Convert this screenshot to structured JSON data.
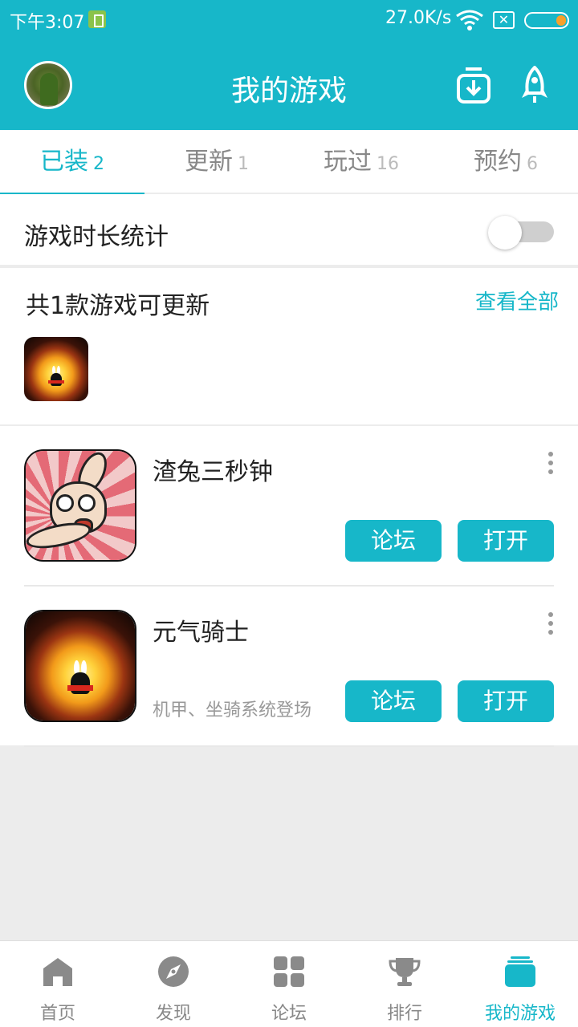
{
  "status_bar": {
    "time": "下午3:07",
    "network_speed": "27.0K/s",
    "icons": [
      "battery-saver-icon",
      "wifi-icon",
      "no-sim-icon",
      "battery-icon"
    ]
  },
  "header": {
    "title": "我的游戏",
    "icons": [
      "avatar",
      "download-icon",
      "rocket-icon"
    ]
  },
  "tabs": [
    {
      "label": "已装",
      "count": "2",
      "active": true
    },
    {
      "label": "更新",
      "count": "1",
      "active": false
    },
    {
      "label": "玩过",
      "count": "16",
      "active": false
    },
    {
      "label": "预约",
      "count": "6",
      "active": false
    }
  ],
  "playtime": {
    "label": "游戏时长统计",
    "toggle_on": false
  },
  "updates": {
    "heading": "共1款游戏可更新",
    "view_all": "查看全部"
  },
  "games": [
    {
      "name": "渣兔三秒钟",
      "subtitle": "",
      "forum_label": "论坛",
      "open_label": "打开"
    },
    {
      "name": "元气骑士",
      "subtitle": "机甲、坐骑系统登场",
      "forum_label": "论坛",
      "open_label": "打开"
    }
  ],
  "bottom_nav": [
    {
      "label": "首页",
      "icon": "home-icon",
      "active": false
    },
    {
      "label": "发现",
      "icon": "compass-icon",
      "active": false
    },
    {
      "label": "论坛",
      "icon": "grid-icon",
      "active": false
    },
    {
      "label": "排行",
      "icon": "trophy-icon",
      "active": false
    },
    {
      "label": "我的游戏",
      "icon": "games-stack-icon",
      "active": true
    }
  ],
  "colors": {
    "accent": "#17b7c9",
    "background": "#ececec",
    "inactive": "#888888"
  }
}
